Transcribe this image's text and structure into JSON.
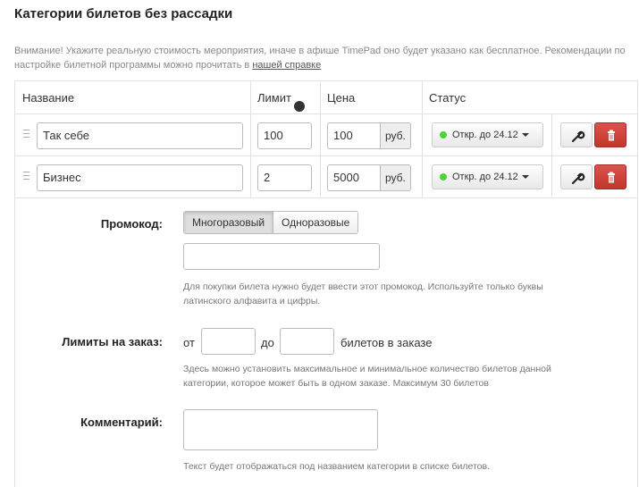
{
  "title": "Категории билетов без рассадки",
  "notice": {
    "text": "Внимание! Укажите реальную стоимость мероприятия, иначе в афише TimePad оно будет указано как бесплатное. Рекомендации по настройке билетной программы можно прочитать в ",
    "link": "нашей справке"
  },
  "table": {
    "columns": {
      "name": "Название",
      "limit": "Лимит",
      "price": "Цена",
      "status": "Статус"
    },
    "limit_help_icon": "?",
    "currency": "руб.",
    "rows": [
      {
        "name": "Так себе",
        "limit": "100",
        "price": "100",
        "status": "Откр. до 24.12"
      },
      {
        "name": "Бизнес",
        "limit": "2",
        "price": "5000",
        "status": "Откр. до 24.12"
      }
    ]
  },
  "details": {
    "promo": {
      "label": "Промокод:",
      "option_multi": "Многоразовый",
      "option_single": "Одноразовые",
      "value": "",
      "help": "Для покупки билета нужно будет ввести этот промокод. Используйте только буквы латинского алфавита и цифры."
    },
    "limits": {
      "label": "Лимиты на заказ:",
      "from": "от",
      "to": "до",
      "from_value": "",
      "to_value": "",
      "suffix": "билетов в заказе",
      "help": "Здесь можно установить максимальное и минимальное количество билетов данной категории, которое может быть в одном заказе. Максимум 30 билетов"
    },
    "comment": {
      "label": "Комментарий:",
      "value": "",
      "help": "Текст будет отображаться под названием категории в списке билетов."
    }
  },
  "colors": {
    "status_dot": "#4cd137",
    "delete_button": "#c9302c"
  },
  "icons": {
    "drag": "drag-handle-icon",
    "edit": "wrench-icon",
    "delete": "trash-icon",
    "help": "question-icon",
    "dropdown": "caret-down-icon"
  }
}
